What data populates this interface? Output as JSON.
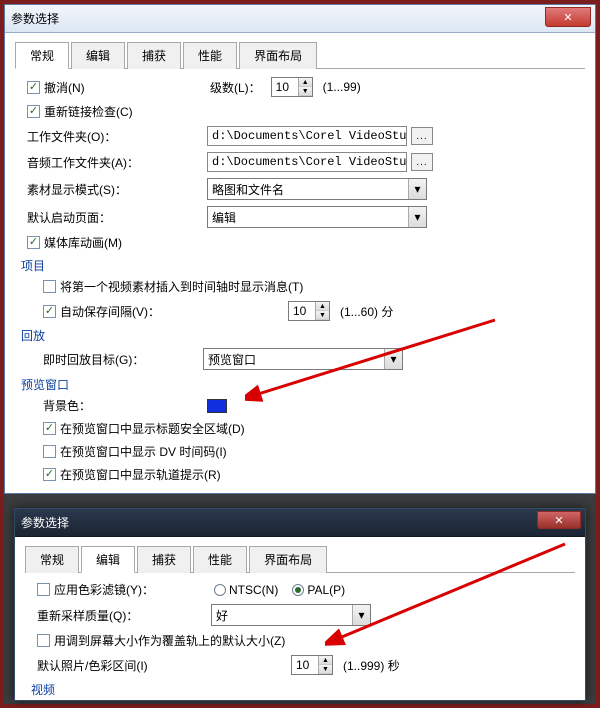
{
  "colors": {
    "bg_swatch": "#1030e0"
  },
  "win1": {
    "title": "参数选择",
    "tabs": [
      "常规",
      "编辑",
      "捕获",
      "性能",
      "界面布局"
    ],
    "active_tab": 0,
    "undo_label": "撤消(N)",
    "levels_label": "级数(L)：",
    "levels_value": "10",
    "levels_range": "(1...99)",
    "relink_label": "重新链接检查(C)",
    "workdir_label": "工作文件夹(O)：",
    "workdir_value": "d:\\Documents\\Corel VideoStu…",
    "audiodir_label": "音频工作文件夹(A)：",
    "audiodir_value": "d:\\Documents\\Corel VideoStu…",
    "clipdisplay_label": "素材显示模式(S)：",
    "clipdisplay_value": "略图和文件名",
    "startpage_label": "默认启动页面：",
    "startpage_value": "编辑",
    "medialib_label": "媒体库动画(M)",
    "section_project": "项目",
    "firstclip_label": "将第一个视频素材插入到时间轴时显示消息(T)",
    "autosave_label": "自动保存间隔(V)：",
    "autosave_value": "10",
    "autosave_range": "(1...60) 分",
    "section_playback": "回放",
    "playback_label": "即时回放目标(G)：",
    "playback_value": "预览窗口",
    "section_preview": "预览窗口",
    "bgcolor_label": "背景色：",
    "safearea_label": "在预览窗口中显示标题安全区域(D)",
    "dvtimecode_label": "在预览窗口中显示 DV 时间码(I)",
    "trackhint_label": "在预览窗口中显示轨道提示(R)"
  },
  "win2": {
    "title": "参数选择",
    "tabs": [
      "常规",
      "编辑",
      "捕获",
      "性能",
      "界面布局"
    ],
    "active_tab": 1,
    "colorfilter_label": "应用色彩滤镜(Y)：",
    "ntsc_label": "NTSC(N)",
    "pal_label": "PAL(P)",
    "resample_label": "重新采样质量(Q)：",
    "resample_value": "好",
    "overlay_label": "用调到屏幕大小作为覆盖轨上的默认大小(Z)",
    "duration_label": "默认照片/色彩区间(I)",
    "duration_value": "10",
    "duration_range": "(1..999) 秒",
    "section_video": "视频"
  }
}
